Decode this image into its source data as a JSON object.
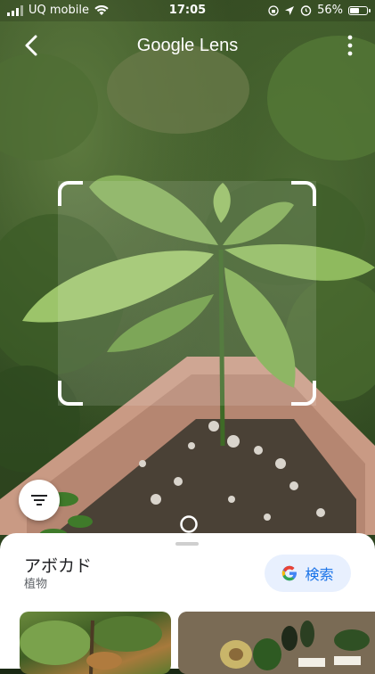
{
  "status_bar": {
    "carrier": "UQ mobile",
    "time": "17:05",
    "battery": "56%",
    "battery_level": 0.56
  },
  "app": {
    "title": "Google Lens"
  },
  "result": {
    "name": "アボカド",
    "category": "植物",
    "search_label": "検索"
  },
  "icons": {
    "back": "back-arrow-icon",
    "more": "more-vert-icon",
    "filter": "filter-list-icon",
    "google": "google-g-icon",
    "wifi": "wifi-icon",
    "signal": "signal-icon",
    "location": "location-arrow-icon",
    "alarm": "alarm-icon",
    "lock": "orientation-lock-icon",
    "battery": "battery-icon"
  },
  "colors": {
    "accent": "#1a73e8",
    "search_bg": "#e8f0fe"
  }
}
